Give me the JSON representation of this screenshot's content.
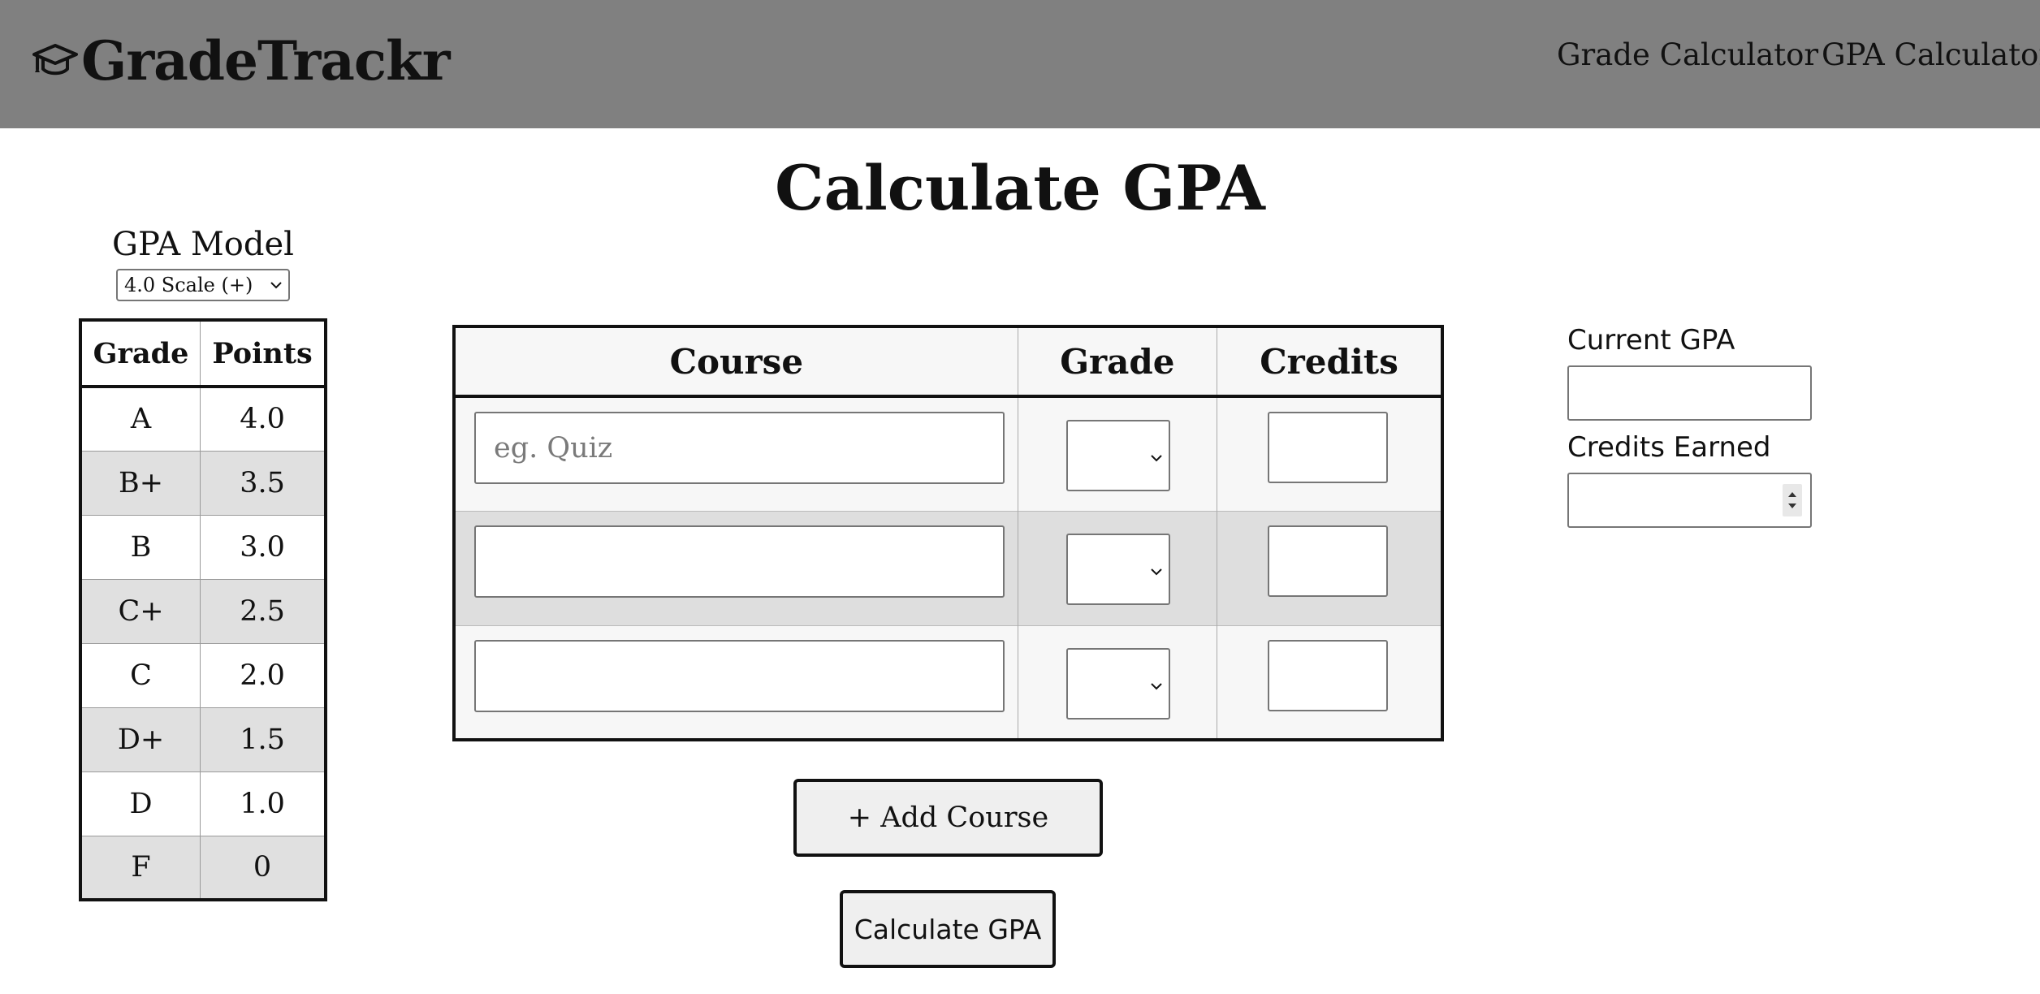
{
  "app": {
    "name": "GradeTrackr",
    "logo_icon": "graduation-cap-icon"
  },
  "nav": {
    "items": [
      {
        "label": "Grade Calculator"
      },
      {
        "label": "GPA Calculator"
      }
    ]
  },
  "page": {
    "title": "Calculate GPA"
  },
  "gpa_model": {
    "label": "GPA Model",
    "selected": "4.0 Scale (+)"
  },
  "scale_table": {
    "headers": [
      "Grade",
      "Points"
    ],
    "rows": [
      {
        "grade": "A",
        "points": "4.0"
      },
      {
        "grade": "B+",
        "points": "3.5"
      },
      {
        "grade": "B",
        "points": "3.0"
      },
      {
        "grade": "C+",
        "points": "2.5"
      },
      {
        "grade": "C",
        "points": "2.0"
      },
      {
        "grade": "D+",
        "points": "1.5"
      },
      {
        "grade": "D",
        "points": "1.0"
      },
      {
        "grade": "F",
        "points": "0"
      }
    ]
  },
  "courses": {
    "headers": [
      "Course",
      "Grade",
      "Credits"
    ],
    "rows": [
      {
        "course_value": "",
        "course_placeholder": "eg. Quiz",
        "grade": "",
        "credits": ""
      },
      {
        "course_value": "",
        "course_placeholder": "",
        "grade": "",
        "credits": ""
      },
      {
        "course_value": "",
        "course_placeholder": "",
        "grade": "",
        "credits": ""
      }
    ]
  },
  "actions": {
    "add_course_label": "+ Add Course",
    "calculate_label": "Calculate GPA"
  },
  "results": {
    "current_gpa_label": "Current GPA",
    "current_gpa_value": "",
    "credits_earned_label": "Credits Earned",
    "credits_earned_value": ""
  },
  "colors": {
    "header_bg": "#808080",
    "stripe_dark": "#dedede",
    "stripe_light": "#f7f7f7"
  }
}
